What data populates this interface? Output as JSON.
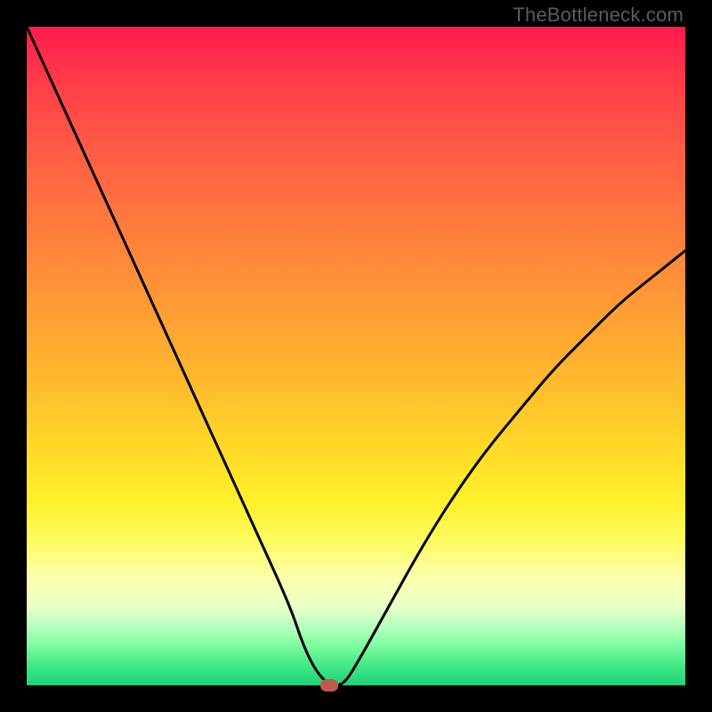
{
  "watermark": "TheBottleneck.com",
  "colors": {
    "frame": "#000000",
    "curve": "#000000",
    "marker": "#c05a4e",
    "gradient_top": "#ff1a4d",
    "gradient_bottom": "#1fd478"
  },
  "chart_data": {
    "type": "line",
    "title": "",
    "xlabel": "",
    "ylabel": "",
    "xlim": [
      0,
      100
    ],
    "ylim": [
      0,
      100
    ],
    "grid": false,
    "legend": false,
    "annotations": [
      "TheBottleneck.com"
    ],
    "series": [
      {
        "name": "bottleneck-curve",
        "x": [
          0,
          5,
          10,
          15,
          20,
          25,
          30,
          35,
          40,
          42,
          44,
          46,
          48,
          50,
          55,
          60,
          65,
          70,
          75,
          80,
          85,
          90,
          95,
          100
        ],
        "values": [
          100,
          89,
          78,
          67,
          56,
          45,
          34,
          23,
          12,
          6,
          2,
          0,
          0,
          3,
          12,
          21,
          29,
          36,
          42,
          48,
          53,
          58,
          62,
          66
        ]
      }
    ],
    "marker": {
      "x": 46,
      "y": 0
    },
    "background_gradient": {
      "direction": "top-to-bottom",
      "stops": [
        {
          "pos": 0,
          "color": "#ff1a4d"
        },
        {
          "pos": 50,
          "color": "#ffba2e"
        },
        {
          "pos": 80,
          "color": "#fbffb0"
        },
        {
          "pos": 100,
          "color": "#1fd478"
        }
      ]
    }
  }
}
